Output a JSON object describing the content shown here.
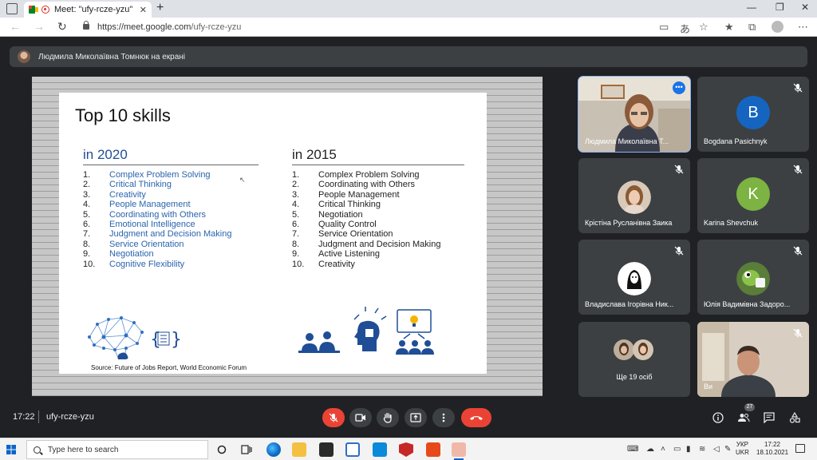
{
  "browser": {
    "tab_title": "Meet: \"ufy-rcze-yzu\"",
    "tab_close": "✕",
    "new_tab": "+",
    "url_host": "https://meet.google.com",
    "url_path": "/ufy-rcze-yzu",
    "window_minimize": "—",
    "window_restore": "❐",
    "window_close": "✕"
  },
  "meet": {
    "presenting_text": "Людмила Миколаївна Томнюк на екрані",
    "time": "17:22",
    "meeting_code": "ufy-rcze-yzu",
    "people_count": "27"
  },
  "slide": {
    "title": "Top 10 skills",
    "left_heading": "in  2020",
    "right_heading": "in  2015",
    "left_items": [
      {
        "num": "1.",
        "text": "Complex Problem Solving"
      },
      {
        "num": "2.",
        "text": "Critical Thinking"
      },
      {
        "num": "3.",
        "text": "Creativity"
      },
      {
        "num": "4.",
        "text": "People Management"
      },
      {
        "num": "5.",
        "text": "Coordinating with Others"
      },
      {
        "num": "6.",
        "text": "Emotional Intelligence"
      },
      {
        "num": "7.",
        "text": "Judgment and Decision Making"
      },
      {
        "num": "8.",
        "text": "Service Orientation"
      },
      {
        "num": "9.",
        "text": "Negotiation"
      },
      {
        "num": "10.",
        "text": "Cognitive Flexibility"
      }
    ],
    "right_items": [
      {
        "num": "1.",
        "text": "Complex Problem Solving"
      },
      {
        "num": "2.",
        "text": "Coordinating with Others"
      },
      {
        "num": "3.",
        "text": "People Management"
      },
      {
        "num": "4.",
        "text": "Critical Thinking"
      },
      {
        "num": "5.",
        "text": "Negotiation"
      },
      {
        "num": "6.",
        "text": "Quality Control"
      },
      {
        "num": "7.",
        "text": "Service Orientation"
      },
      {
        "num": "8.",
        "text": "Judgment and Decision Making"
      },
      {
        "num": "9.",
        "text": "Active Listening"
      },
      {
        "num": "10.",
        "text": "Creativity"
      }
    ],
    "source": "Source: Future of Jobs Report, World Economic Forum"
  },
  "participants": [
    {
      "name": "Людмила Миколаївна Т...",
      "type": "video",
      "speaking": true
    },
    {
      "name": "Bogdana Pasichnyk",
      "letter": "B",
      "color": "#1565c0",
      "muted": true
    },
    {
      "name": "Крістіна Русланівна Заика",
      "type": "photo",
      "muted": true
    },
    {
      "name": "Karina Shevchuk",
      "letter": "K",
      "color": "#7cb342",
      "muted": true
    },
    {
      "name": "Владислава Ігорівна Ник...",
      "type": "photo",
      "muted": true
    },
    {
      "name": "Юлія Вадимівна Задоро...",
      "type": "photo",
      "muted": true
    },
    {
      "name": "Ще 19 осіб",
      "type": "others"
    },
    {
      "name": "Ви",
      "type": "video",
      "muted": true
    }
  ],
  "taskbar": {
    "search_placeholder": "Type here to search",
    "lang_top": "УКР",
    "lang_bottom": "UKR",
    "clock_time": "17:22",
    "clock_date": "18.10.2021"
  },
  "colors": {
    "meet_bg": "#202124",
    "tile_bg": "#3c4043",
    "red": "#ea4335",
    "slide_blue": "#2a64ad",
    "accent_blue": "#1a73e8"
  }
}
